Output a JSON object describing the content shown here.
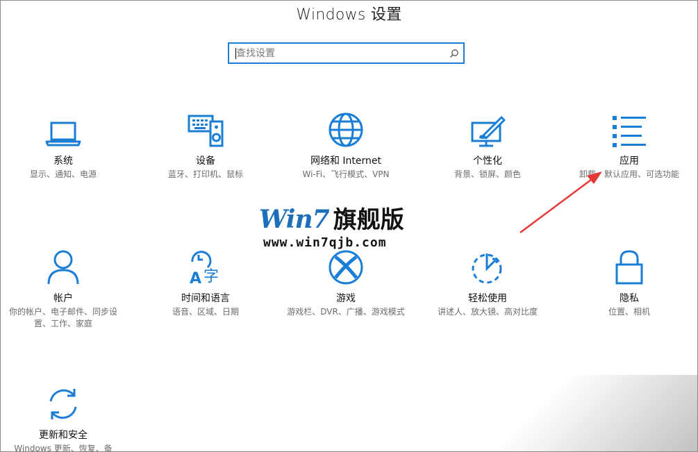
{
  "page": {
    "title": "Windows 设置"
  },
  "search": {
    "placeholder": "查找设置"
  },
  "tiles": [
    {
      "name": "系统",
      "desc": "显示、通知、电源",
      "icon": "laptop-icon"
    },
    {
      "name": "设备",
      "desc": "蓝牙、打印机、鼠标",
      "icon": "keyboard-speaker-icon"
    },
    {
      "name": "网络和 Internet",
      "desc": "Wi-Fi、飞行模式、VPN",
      "icon": "globe-icon"
    },
    {
      "name": "个性化",
      "desc": "背景、锁屏、颜色",
      "icon": "paint-monitor-icon"
    },
    {
      "name": "应用",
      "desc": "卸载、默认应用、可选功能",
      "icon": "app-list-icon"
    },
    {
      "name": "帐户",
      "desc": "你的帐户、电子邮件、同步设置、工作、家庭",
      "icon": "person-icon"
    },
    {
      "name": "时间和语言",
      "desc": "语音、区域、日期",
      "icon": "time-language-icon"
    },
    {
      "name": "游戏",
      "desc": "游戏栏、DVR、广播、游戏模式",
      "icon": "xbox-icon"
    },
    {
      "name": "轻松使用",
      "desc": "讲述人、放大镜、高对比度",
      "icon": "ease-of-access-icon"
    },
    {
      "name": "隐私",
      "desc": "位置、相机",
      "icon": "lock-icon"
    },
    {
      "name": "更新和安全",
      "desc": "Windows 更新、恢复、备",
      "icon": "sync-icon"
    }
  ],
  "watermark": {
    "logo": "Win7",
    "logo_cn": "旗舰版",
    "url": "www.win7qjb.com"
  },
  "colors": {
    "accent": "#1b7ed6",
    "arrow": "#e53935"
  }
}
